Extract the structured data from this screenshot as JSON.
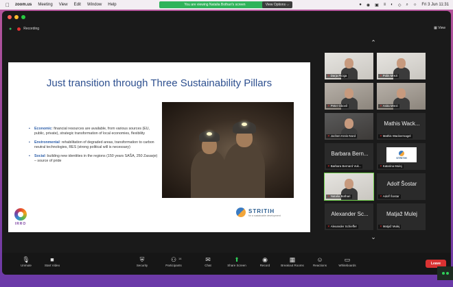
{
  "menubar": {
    "apple": "",
    "app": "zoom.us",
    "items": [
      "Meeting",
      "View",
      "Edit",
      "Window",
      "Help"
    ],
    "share_banner": "You are viewing Natalia Bothari's screen",
    "view_options": "View Options ⌵",
    "right_icons": [
      "●",
      "◉",
      "▣",
      "≡",
      "◐",
      "◇",
      "⌕",
      "☼"
    ],
    "clock": "Fri 3 Jun 11:31"
  },
  "window": {
    "recording": "Recording",
    "view_label": "View"
  },
  "slide": {
    "title": "Just transition through Three Sustainability Pillars",
    "bullets": [
      {
        "key": "Economic",
        "text": ": financial resources are available, from various sources (EU, public, private), strategic transformation of local economies, flexibility"
      },
      {
        "key": "Environmental",
        "text": ": rehabilitation of degraded areas, transformation to carbon neutral technologies, RES (strong political will is necessary)"
      },
      {
        "key": "Social",
        "text": ": building new identities in the regions (150 years SAŠA, 250 Zasavje) – source of pride"
      }
    ],
    "logo_left": "IRRO",
    "logo_right": "STRITIH",
    "logo_right_sub": "for a sustainable development"
  },
  "gallery": {
    "tiles": [
      {
        "name": "Darja Piciga",
        "big": "",
        "kind": "video",
        "variant": "light"
      },
      {
        "name": "Polin Mrezi",
        "big": "",
        "kind": "video",
        "variant": "light"
      },
      {
        "name": "Peter Gbovil",
        "big": "",
        "kind": "video",
        "variant": ""
      },
      {
        "name": "Anita Mrezi",
        "big": "",
        "kind": "video",
        "variant": ""
      },
      {
        "name": "Jochen Kreis-Nord",
        "big": "",
        "kind": "video",
        "variant": "dark"
      },
      {
        "name": "Mathis Wackermagel",
        "big": "Mathis Wack...",
        "kind": "name"
      },
      {
        "name": "Barbara Bernard Vuk...",
        "big": "Barbara Bern...",
        "kind": "name"
      },
      {
        "name": "Katarina Mulej",
        "big": "",
        "kind": "logo",
        "logo_text": "STRITIH"
      },
      {
        "name": "Natalia Bothari",
        "big": "",
        "kind": "video",
        "variant": "light",
        "active": true
      },
      {
        "name": "Adolf Šostar",
        "big": "Adolf Šostar",
        "kind": "name"
      },
      {
        "name": "Alexander Schieffer",
        "big": "Alexander Sc...",
        "kind": "name"
      },
      {
        "name": "Matjaž Mulej",
        "big": "Matjaž Mulej",
        "kind": "name"
      }
    ],
    "chevron_up": "⌃",
    "chevron_down": "⌄"
  },
  "toolbar": {
    "buttons": [
      {
        "label": "Unmute",
        "icon": "🎙",
        "name": "unmute-button"
      },
      {
        "label": "Start Video",
        "icon": "■",
        "name": "start-video-button"
      },
      {
        "label": "Security",
        "icon": "⛨",
        "name": "security-button"
      },
      {
        "label": "Participants",
        "icon": "⚇",
        "count": "14",
        "name": "participants-button"
      },
      {
        "label": "Chat",
        "icon": "✉",
        "name": "chat-button"
      },
      {
        "label": "Share Screen",
        "icon": "⬆",
        "name": "share-screen-button",
        "green": true
      },
      {
        "label": "Record",
        "icon": "◉",
        "name": "record-button"
      },
      {
        "label": "Breakout Rooms",
        "icon": "▦",
        "name": "breakout-rooms-button"
      },
      {
        "label": "Reactions",
        "icon": "☺",
        "name": "reactions-button"
      },
      {
        "label": "Whiteboards",
        "icon": "▭",
        "name": "whiteboards-button"
      }
    ],
    "leave": "Leave"
  }
}
